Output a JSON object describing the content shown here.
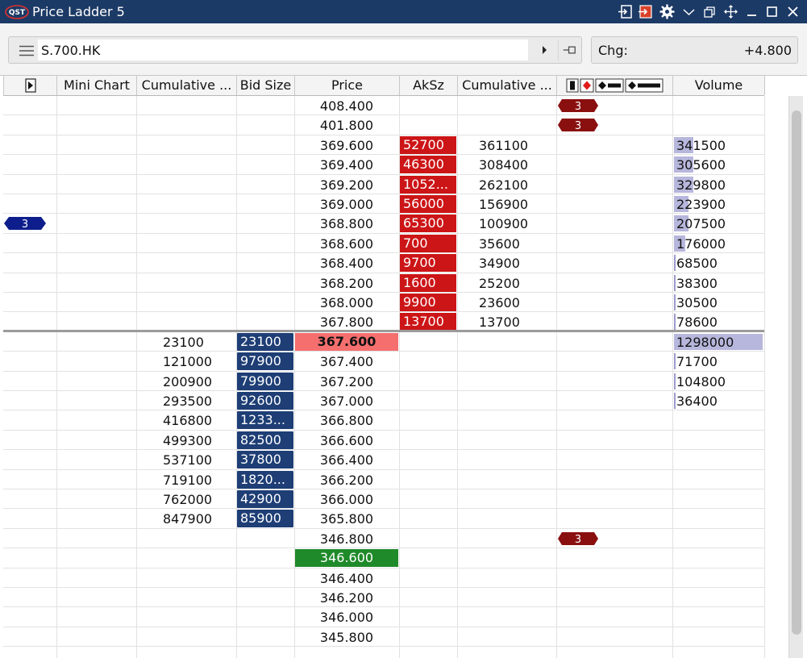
{
  "window": {
    "title": "Price Ladder 5",
    "logo_text": "QST"
  },
  "toolbar": {
    "symbol": "S.700.HK",
    "chg_label": "Chg:",
    "chg_value": "+4.800"
  },
  "columns": [
    {
      "key": "arrow",
      "label": ""
    },
    {
      "key": "mini_chart",
      "label": "Mini Chart"
    },
    {
      "key": "cum_bid",
      "label": "Cumulative ..."
    },
    {
      "key": "bid_size",
      "label": "Bid Size"
    },
    {
      "key": "price",
      "label": "Price"
    },
    {
      "key": "ask_size",
      "label": "AkSz"
    },
    {
      "key": "cum_ask",
      "label": "Cumulative ..."
    },
    {
      "key": "orders",
      "label": ""
    },
    {
      "key": "volume",
      "label": "Volume"
    }
  ],
  "rows": [
    {
      "price": "408.400",
      "order_badge": "3"
    },
    {
      "price": "401.800",
      "order_badge": "3"
    },
    {
      "price": "369.600",
      "ask": "52700",
      "cum_ask": "361100",
      "volume": "341500",
      "vol_fraction": 0.02
    },
    {
      "price": "369.400",
      "ask": "46300",
      "cum_ask": "308400",
      "volume": "305600",
      "vol_fraction": 0.02
    },
    {
      "price": "369.200",
      "ask": "1052...",
      "cum_ask": "262100",
      "volume": "329800",
      "vol_fraction": 0.02
    },
    {
      "price": "369.000",
      "ask": "56000",
      "cum_ask": "156900",
      "volume": "223900",
      "vol_fraction": 0.015
    },
    {
      "price": "368.800",
      "ask": "65300",
      "cum_ask": "100900",
      "volume": "207500",
      "vol_fraction": 0.015,
      "left_badge": "3"
    },
    {
      "price": "368.600",
      "ask": "700",
      "cum_ask": "35600",
      "volume": "176000",
      "vol_fraction": 0.012
    },
    {
      "price": "368.400",
      "ask": "9700",
      "cum_ask": "34900",
      "volume": "68500",
      "vol_fraction": 0.005
    },
    {
      "price": "368.200",
      "ask": "1600",
      "cum_ask": "25200",
      "volume": "38300",
      "vol_fraction": 0.003
    },
    {
      "price": "368.000",
      "ask": "9900",
      "cum_ask": "23600",
      "volume": "30500",
      "vol_fraction": 0.002
    },
    {
      "price": "367.800",
      "ask": "13700",
      "cum_ask": "13700",
      "volume": "78600",
      "vol_fraction": 0.006
    },
    {
      "price": "367.600",
      "bid": "23100",
      "cum_bid": "23100",
      "volume": "1298000",
      "vol_fraction": 1.0,
      "best_bid": true
    },
    {
      "price": "367.400",
      "bid": "97900",
      "cum_bid": "121000",
      "volume": "71700",
      "vol_fraction": 0.006
    },
    {
      "price": "367.200",
      "bid": "79900",
      "cum_bid": "200900",
      "volume": "104800",
      "vol_fraction": 0.008
    },
    {
      "price": "367.000",
      "bid": "92600",
      "cum_bid": "293500",
      "volume": "36400",
      "vol_fraction": 0.003
    },
    {
      "price": "366.800",
      "bid": "1233...",
      "cum_bid": "416800"
    },
    {
      "price": "366.600",
      "bid": "82500",
      "cum_bid": "499300"
    },
    {
      "price": "366.400",
      "bid": "37800",
      "cum_bid": "537100"
    },
    {
      "price": "366.200",
      "bid": "1820...",
      "cum_bid": "719100"
    },
    {
      "price": "366.000",
      "bid": "42900",
      "cum_bid": "762000"
    },
    {
      "price": "365.800",
      "bid": "85900",
      "cum_bid": "847900"
    },
    {
      "price": "346.800",
      "order_badge": "3"
    },
    {
      "price": "346.600",
      "highlight": "green"
    },
    {
      "price": "346.400"
    },
    {
      "price": "346.200"
    },
    {
      "price": "346.000"
    },
    {
      "price": "345.800"
    }
  ],
  "colors": {
    "titlebar": "#1c3a66",
    "bid": "#1e3e75",
    "ask": "#cc1517",
    "best_bid_price": "#f56f6f",
    "green_price": "#1f8a2a",
    "volume_bar": "#b7b6dc",
    "order_badge": "#8a1010",
    "position_badge": "#0d1e8c"
  }
}
